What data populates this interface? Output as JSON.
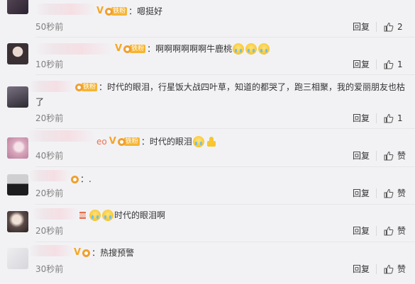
{
  "comments": [
    {
      "text": "：嗯挺好",
      "time": "50秒前",
      "reply": "回复",
      "likes": "2"
    },
    {
      "text": "：啊啊啊啊啊啊牛鹿桃",
      "time": "10秒前",
      "reply": "回复",
      "likes": "1"
    },
    {
      "text": "：时代的眼泪，行星饭大战四叶草，知道的都哭了，跑三相聚，我的爱丽朋友也枯",
      "text2": "了",
      "time": "20秒前",
      "reply": "回复",
      "likes": "1"
    },
    {
      "text": "：时代的眼泪",
      "name_tail": "eo",
      "time": "40秒前",
      "reply": "回复",
      "likes": "赞"
    },
    {
      "text": "：.",
      "time": "20秒前",
      "reply": "回复",
      "likes": "赞"
    },
    {
      "text": "时代的眼泪啊",
      "time": "20秒前",
      "reply": "回复",
      "likes": "赞"
    },
    {
      "text": "：热搜预警",
      "time": "30秒前",
      "reply": "回复",
      "likes": "赞"
    }
  ],
  "fan_badge": "铁粉",
  "v_badge": "V",
  "colors": {
    "background": "#f2f2f5",
    "badge": "#f6b532",
    "time": "#808080"
  }
}
